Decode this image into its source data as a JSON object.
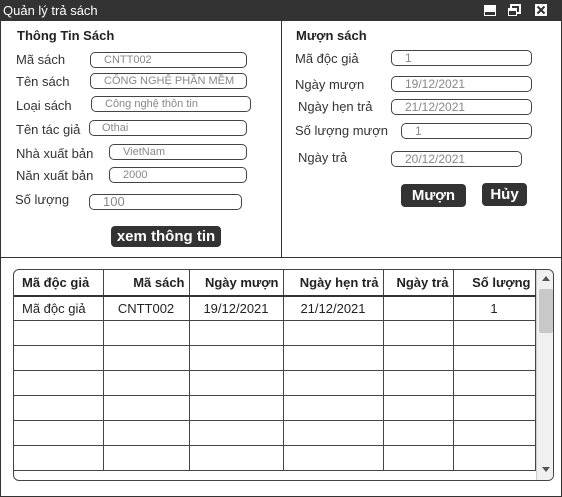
{
  "window": {
    "title": "Quản lý trả sách"
  },
  "book_info": {
    "heading": "Thông Tin Sách",
    "fields": [
      {
        "label": "Mã sách",
        "value": "CNTT002"
      },
      {
        "label": "Tên sách",
        "value": "CÔNG NGHỆ PHẦN MỀM"
      },
      {
        "label": "Loại sách",
        "value": "Công nghệ thôn tin"
      },
      {
        "label": "Tên tác giả",
        "value": "Othai"
      },
      {
        "label": "Nhà xuất bản",
        "value": "VietNam"
      },
      {
        "label": "Năn xuất bản",
        "value": "2000"
      },
      {
        "label": "Số lượng",
        "value": "100"
      }
    ],
    "view_button": "xem thông tin"
  },
  "borrow": {
    "heading": "Mượn sách",
    "fields": [
      {
        "label": "Mã độc giả",
        "value": "1"
      },
      {
        "label": "Ngày mượn",
        "value": "19/12/2021"
      },
      {
        "label": "Ngày hẹn trả",
        "value": "21/12/2021"
      },
      {
        "label": "Số lượng mượn",
        "value": "1"
      },
      {
        "label": "Ngày trả",
        "value": "20/12/2021"
      }
    ],
    "borrow_button": "Mượn",
    "cancel_button": "Hủy"
  },
  "table": {
    "columns": [
      "Mã độc giả",
      "Mã sách",
      "Ngày mượn",
      "Ngày hẹn trả",
      "Ngày trả",
      "Số lượng"
    ],
    "rows": [
      [
        "Mã độc giả",
        "CNTT002",
        "19/12/2021",
        "21/12/2021",
        "",
        "1"
      ]
    ],
    "empty_rows": 6
  }
}
